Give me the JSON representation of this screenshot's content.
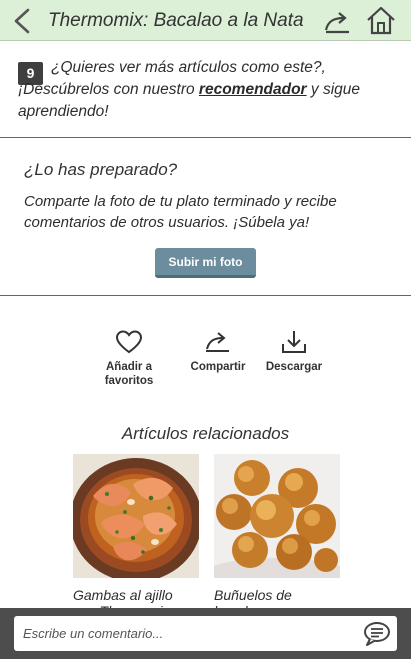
{
  "header": {
    "title": "Thermomix: Bacalao a la Nata",
    "back_icon": "back-chevron-icon",
    "share_icon": "share-arrow-icon",
    "home_icon": "home-icon"
  },
  "recommendation": {
    "step_number": "9",
    "text_before": "¿Quieres ver más artículos como este?, ¡Descúbrelos con nuestro ",
    "link_label": "recomendador",
    "text_after": " y sigue aprendiendo!"
  },
  "upload": {
    "title": "¿Lo has preparado?",
    "description": "Comparte la foto de tu plato terminado y recibe comentarios de otros usuarios. ¡Súbela ya!",
    "button_label": "Subir mi foto"
  },
  "actions": {
    "favorite_label_line1": "Añadir a",
    "favorite_label_line2": "favoritos",
    "share_label": "Compartir",
    "download_label": "Descargar"
  },
  "related": {
    "title": "Artículos relacionados",
    "items": [
      {
        "title_line1": "Gambas al ajillo",
        "title_line2": "con Thermomix",
        "image": "shrimp-dish"
      },
      {
        "title_line1": "Buñuelos de",
        "title_line2": "bacalao con",
        "image": "cod-fritters"
      }
    ]
  },
  "comment": {
    "placeholder": "Escribe un comentario..."
  },
  "colors": {
    "header_bg": "#dcefd7",
    "upload_button": "#6c8d9d",
    "comment_bar": "#4d4d4d"
  }
}
